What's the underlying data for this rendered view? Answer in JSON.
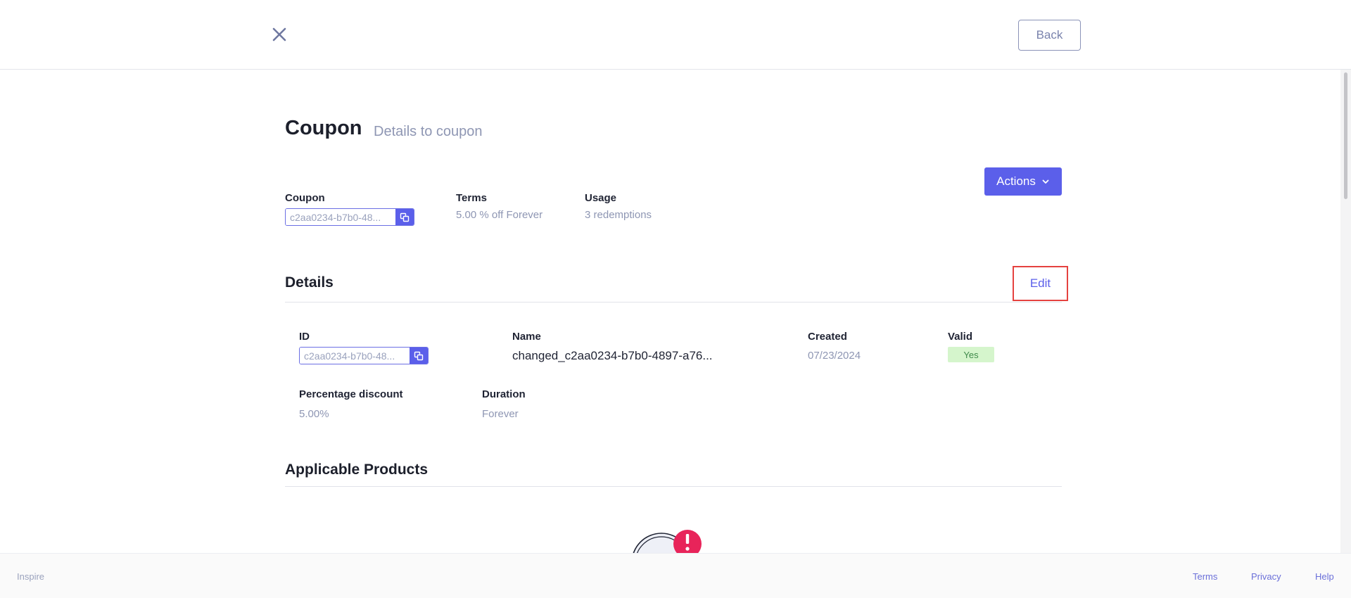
{
  "header": {
    "close_icon": "close-icon",
    "back_label": "Back"
  },
  "page": {
    "title": "Coupon",
    "subtitle": "Details to coupon",
    "actions_label": "Actions"
  },
  "summary": {
    "coupon_label": "Coupon",
    "coupon_value": "c2aa0234-b7b0-48...",
    "terms_label": "Terms",
    "terms_value": "5.00 % off Forever",
    "usage_label": "Usage",
    "usage_value": "3 redemptions"
  },
  "details": {
    "title": "Details",
    "edit_label": "Edit",
    "id_label": "ID",
    "id_value": "c2aa0234-b7b0-48...",
    "name_label": "Name",
    "name_value": "changed_c2aa0234-b7b0-4897-a76...",
    "created_label": "Created",
    "created_value": "07/23/2024",
    "valid_label": "Valid",
    "valid_value": "Yes",
    "percentage_label": "Percentage discount",
    "percentage_value": "5.00%",
    "duration_label": "Duration",
    "duration_value": "Forever"
  },
  "applicable_products": {
    "title": "Applicable Products"
  },
  "footer": {
    "brand": "Inspire",
    "links": [
      "Terms",
      "Privacy",
      "Help"
    ]
  },
  "colors": {
    "accent": "#5b5fea",
    "muted_text": "#8e96b3",
    "badge_bg": "#d5f5cc",
    "highlight_border": "#e5423f",
    "alert_red": "#e8245a"
  }
}
